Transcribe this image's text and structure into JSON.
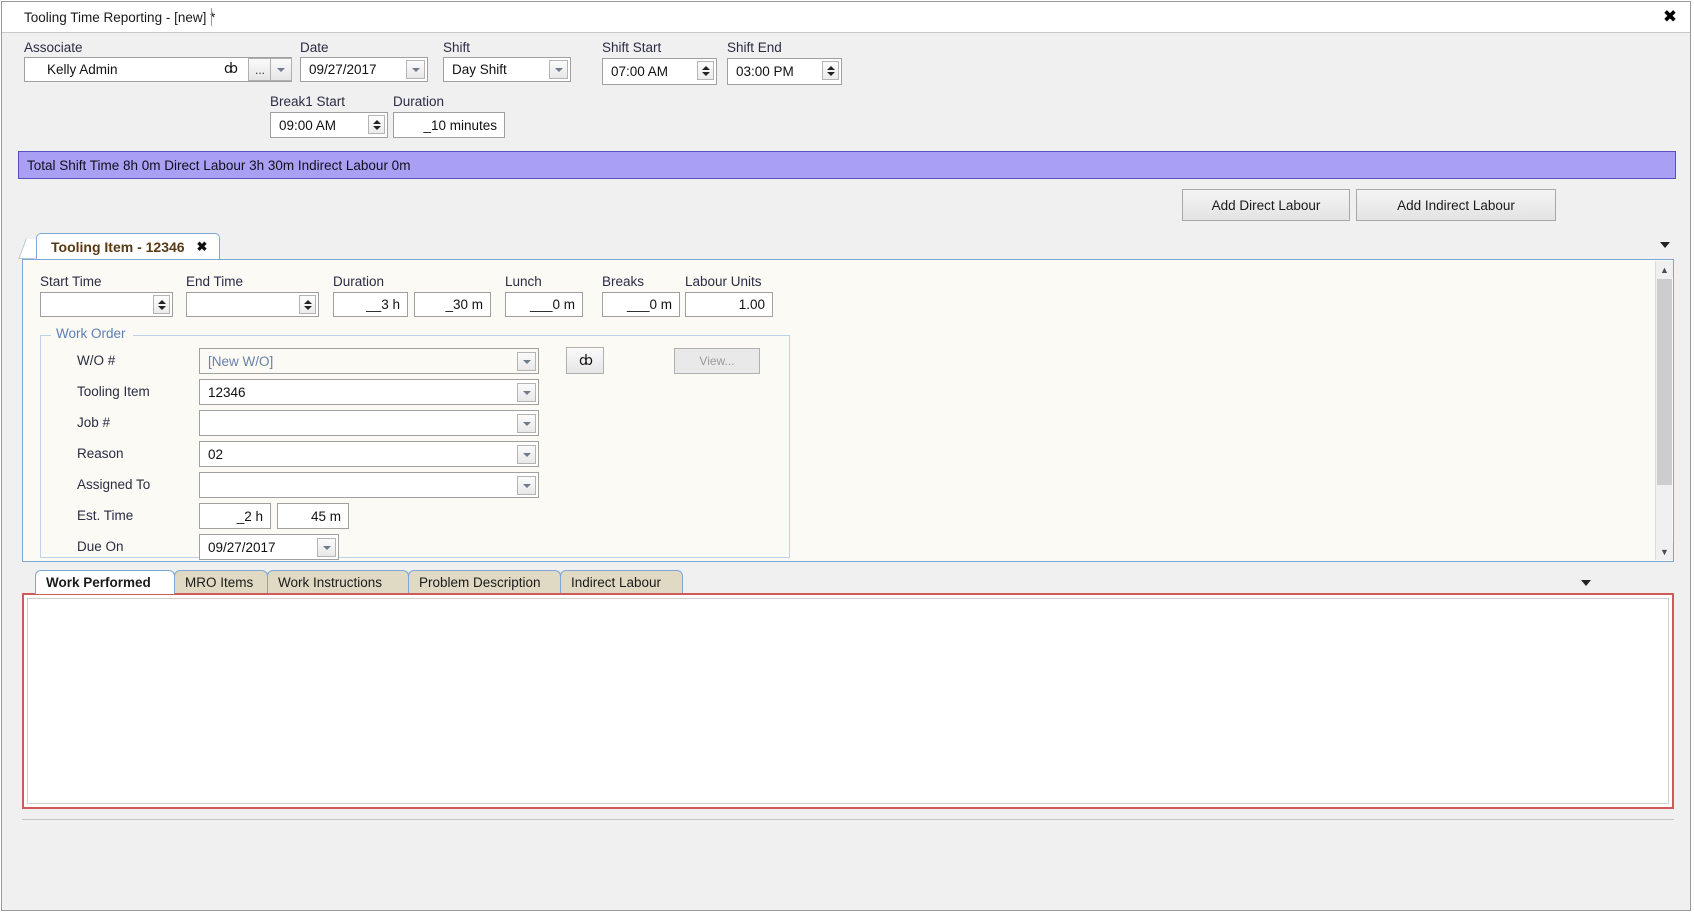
{
  "window": {
    "doc_tab_title": "Tooling Time Reporting - [new] *",
    "close_icon": "close-icon",
    "close_glyph": "✖"
  },
  "header": {
    "associate": {
      "label": "Associate",
      "value": "Kelly Admin",
      "find_icon": "binoculars-icon",
      "find_glyph": "ȸ",
      "ellipsis_label": "...",
      "dropdown_icon": "chevron-down-icon"
    },
    "date": {
      "label": "Date",
      "value": "09/27/2017"
    },
    "shift": {
      "label": "Shift",
      "value": "Day Shift"
    },
    "shift_start": {
      "label": "Shift Start",
      "value": "07:00 AM"
    },
    "shift_end": {
      "label": "Shift End",
      "value": "03:00 PM"
    },
    "break1_start": {
      "label": "Break1 Start",
      "value": "09:00 AM"
    },
    "break1_duration": {
      "label": "Duration",
      "value": "_10 minutes"
    }
  },
  "summary": {
    "text": "Total Shift Time 8h 0m  Direct Labour 3h 30m  Indirect Labour 0m",
    "background_color": "#a9a0f4",
    "border_color": "#5a4fc0"
  },
  "actions": {
    "add_direct_labour": "Add Direct Labour",
    "add_indirect_labour": "Add Indirect Labour"
  },
  "item_tab": {
    "title": "Tooling Item - 12346",
    "close_glyph": "✖",
    "overflow_icon": "chevron-down-icon"
  },
  "detail": {
    "start_time": {
      "label": "Start Time",
      "value": ""
    },
    "end_time": {
      "label": "End Time",
      "value": ""
    },
    "duration_hours": {
      "label": "Duration",
      "value": "__3 h"
    },
    "duration_minutes": {
      "value": "_30 m"
    },
    "lunch": {
      "label": "Lunch",
      "value": "___0 m"
    },
    "breaks": {
      "label": "Breaks",
      "value": "___0 m"
    },
    "labour_units": {
      "label": "Labour Units",
      "value": "1.00"
    },
    "work_order": {
      "legend": "Work Order",
      "wo_number": {
        "label": "W/O #",
        "value": "[New W/O]"
      },
      "tooling_item": {
        "label": "Tooling Item",
        "value": "12346"
      },
      "job_number": {
        "label": "Job #",
        "value": ""
      },
      "reason": {
        "label": "Reason",
        "value": "02"
      },
      "assigned_to": {
        "label": "Assigned To",
        "value": ""
      },
      "est_time": {
        "label": "Est. Time",
        "hours": "_2 h",
        "minutes": "45 m"
      },
      "due_on": {
        "label": "Due On",
        "value": "09/27/2017"
      },
      "find_icon": "binoculars-icon",
      "find_glyph": "ȸ",
      "view_button": "View..."
    }
  },
  "bottom_tabs": [
    {
      "label": "Work Performed",
      "active": true
    },
    {
      "label": "MRO Items",
      "active": false
    },
    {
      "label": "Work Instructions",
      "active": false
    },
    {
      "label": "Problem Description",
      "active": false
    },
    {
      "label": "Indirect Labour",
      "active": false
    }
  ],
  "work_performed": {
    "value": "",
    "highlight_color": "#d05a5a"
  }
}
